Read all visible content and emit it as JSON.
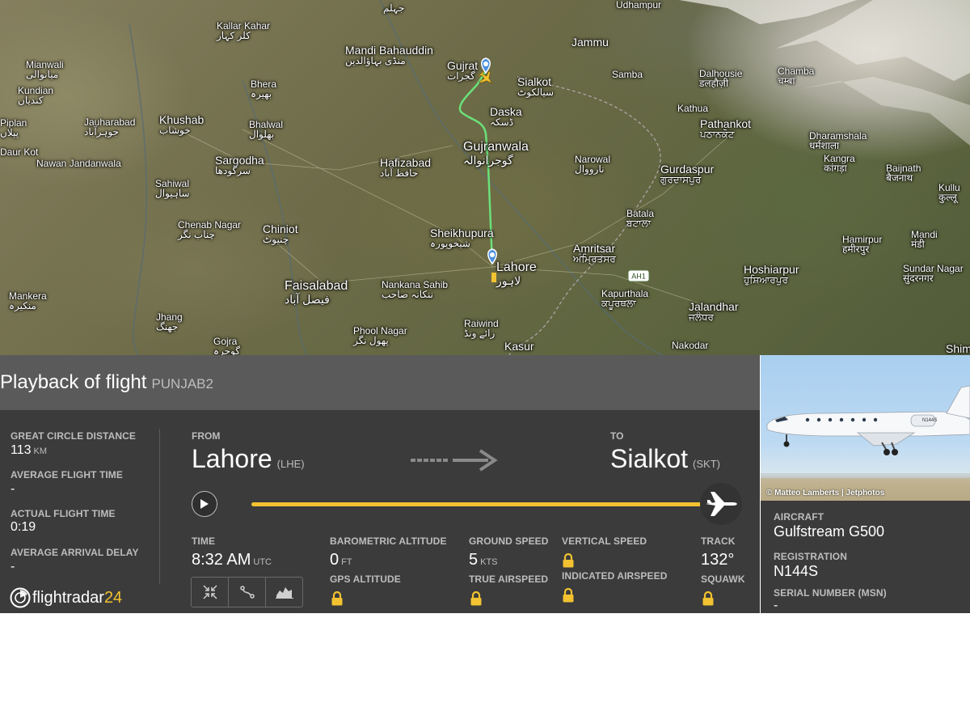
{
  "map": {
    "cities": [
      {
        "name": "Jhelum",
        "native": "جہلم",
        "size": "sm"
      },
      {
        "name": "Udhampur",
        "native": "",
        "size": "sm"
      },
      {
        "name": "Kallar Kahar",
        "native": "کلر کہار",
        "size": "sm"
      },
      {
        "name": "Jammu",
        "native": "",
        "size": "med"
      },
      {
        "name": "Mandi Bahauddin",
        "native": "منڈی بہاؤالدین",
        "size": "med"
      },
      {
        "name": "Gujrat",
        "native": "گجرات",
        "size": "med"
      },
      {
        "name": "Mianwali",
        "native": "میانوالی",
        "size": "sm"
      },
      {
        "name": "Kundian",
        "native": "کندیاں",
        "size": "sm"
      },
      {
        "name": "Bhera",
        "native": "بھیرہ",
        "size": "sm"
      },
      {
        "name": "Sialkot",
        "native": "سیالکوٹ",
        "size": "med"
      },
      {
        "name": "Samba",
        "native": "",
        "size": "sm"
      },
      {
        "name": "Dalhousie",
        "native": "डलहौज़ी",
        "size": "sm"
      },
      {
        "name": "Chamba",
        "native": "चम्बा",
        "size": "sm"
      },
      {
        "name": "Khushab",
        "native": "خوشاب",
        "size": "med"
      },
      {
        "name": "Jauharabad",
        "native": "جوہرآباد",
        "size": "sm"
      },
      {
        "name": "Bhalwal",
        "native": "بھلوال",
        "size": "sm"
      },
      {
        "name": "Daska",
        "native": "ڈسکہ",
        "size": "med"
      },
      {
        "name": "Kathua",
        "native": "",
        "size": "sm"
      },
      {
        "name": "Pathankot",
        "native": "ਪਠਾਨਕੋਟ",
        "size": "med"
      },
      {
        "name": "Dharamshala",
        "native": "धर्मशाला",
        "size": "sm"
      },
      {
        "name": "Piplan",
        "native": "پپلاں",
        "size": "sm"
      },
      {
        "name": "Gujranwala",
        "native": "گوجرانوالہ",
        "size": "big"
      },
      {
        "name": "Kangra",
        "native": "कांगड़ा",
        "size": "sm"
      },
      {
        "name": "Baijnath",
        "native": "बैजनाथ",
        "size": "sm"
      },
      {
        "name": "Daur Kot",
        "native": "",
        "size": "sm"
      },
      {
        "name": "Sargodha",
        "native": "سرگودھا",
        "size": "med"
      },
      {
        "name": "Narowal",
        "native": "نارووال",
        "size": "sm"
      },
      {
        "name": "Nawan Jandanwala",
        "native": "",
        "size": "sm"
      },
      {
        "name": "Hafizabad",
        "native": "حافظ آباد",
        "size": "med"
      },
      {
        "name": "Gurdaspur",
        "native": "ਗੁਰਦਾਸਪੁਰ",
        "size": "med"
      },
      {
        "name": "Sahiwal",
        "native": "ساہیوال",
        "size": "sm"
      },
      {
        "name": "Kullu",
        "native": "कुल्लू",
        "size": "sm"
      },
      {
        "name": "Chenab Nagar",
        "native": "چناب نگر",
        "size": "sm"
      },
      {
        "name": "Chiniot",
        "native": "چنیوٹ",
        "size": "med"
      },
      {
        "name": "Batala",
        "native": "ਬਟਾਲਾ",
        "size": "sm"
      },
      {
        "name": "Sheikhupura",
        "native": "شیخوپورہ",
        "size": "med"
      },
      {
        "name": "Mandi",
        "native": "मंडी",
        "size": "sm"
      },
      {
        "name": "Hamirpur",
        "native": "हमीरपुर",
        "size": "sm"
      },
      {
        "name": "Amritsar",
        "native": "ਅੰਮ੍ਰਿਤਸਰ",
        "size": "med"
      },
      {
        "name": "Lahore",
        "native": "لاہور",
        "size": "big"
      },
      {
        "name": "Hoshiarpur",
        "native": "ਹੁਸ਼ਿਆਰਪੁਰ",
        "size": "med"
      },
      {
        "name": "Sundar Nagar",
        "native": "सुंदरनगर",
        "size": "sm"
      },
      {
        "name": "Faisalabad",
        "native": "فیصل آباد",
        "size": "big"
      },
      {
        "name": "Nankana Sahib",
        "native": "ننکانہ صاحب",
        "size": "sm"
      },
      {
        "name": "Mankera",
        "native": "منکیرہ",
        "size": "sm"
      },
      {
        "name": "Kapurthala",
        "native": "ਕਪੂਰਥਲਾ",
        "size": "sm"
      },
      {
        "name": "Jalandhar",
        "native": "ਜਲੰਧਰ",
        "size": "med"
      },
      {
        "name": "Jhang",
        "native": "جھنگ",
        "size": "sm"
      },
      {
        "name": "Raiwind",
        "native": "رائے ونڈ",
        "size": "sm"
      },
      {
        "name": "Phool Nagar",
        "native": "پھول نگر",
        "size": "sm"
      },
      {
        "name": "Gojra",
        "native": "گوجرہ",
        "size": "sm"
      },
      {
        "name": "Kasur",
        "native": "",
        "size": "med"
      },
      {
        "name": "Nakodar",
        "native": "",
        "size": "sm"
      },
      {
        "name": "Shimla",
        "native": "",
        "size": "med"
      }
    ],
    "highway_shield": "AH1",
    "colors": {
      "route": "#6be07a",
      "pin": "#4a90e2",
      "marker": "#f2c230"
    }
  },
  "header": {
    "title": "Playback of flight",
    "callsign": "PUNJAB2"
  },
  "stats": {
    "distance_label": "GREAT CIRCLE DISTANCE",
    "distance_value": "113",
    "distance_unit": "KM",
    "avg_time_label": "AVERAGE FLIGHT TIME",
    "avg_time_value": "-",
    "actual_time_label": "ACTUAL FLIGHT TIME",
    "actual_time_value": "0:19",
    "avg_delay_label": "AVERAGE ARRIVAL DELAY",
    "avg_delay_value": "-"
  },
  "route": {
    "from_label": "FROM",
    "from_city": "Lahore",
    "from_code": "(LHE)",
    "to_label": "TO",
    "to_city": "Sialkot",
    "to_code": "(SKT)",
    "progress": 1.0
  },
  "telemetry": {
    "time_label": "TIME",
    "time_value": "8:32 AM",
    "time_unit": "UTC",
    "baro_label": "BAROMETRIC ALTITUDE",
    "baro_value": "0",
    "baro_unit": "FT",
    "gps_label": "GPS ALTITUDE",
    "ground_speed_label": "GROUND SPEED",
    "ground_speed_value": "5",
    "ground_speed_unit": "KTS",
    "true_airspeed_label": "TRUE AIRSPEED",
    "vertical_speed_label": "VERTICAL SPEED",
    "indicated_airspeed_label": "INDICATED AIRSPEED",
    "track_label": "TRACK",
    "track_value": "132°",
    "squawk_label": "SQUAWK"
  },
  "logo": {
    "main": "flightradar",
    "accent": "24"
  },
  "aircraft": {
    "photo_credit": "© Matteo Lamberts | Jetphotos",
    "tail": "N144S",
    "aircraft_label": "AIRCRAFT",
    "aircraft_value": "Gulfstream G500",
    "registration_label": "REGISTRATION",
    "registration_value": "N144S",
    "serial_label": "SERIAL NUMBER (MSN)",
    "serial_value": "-"
  }
}
